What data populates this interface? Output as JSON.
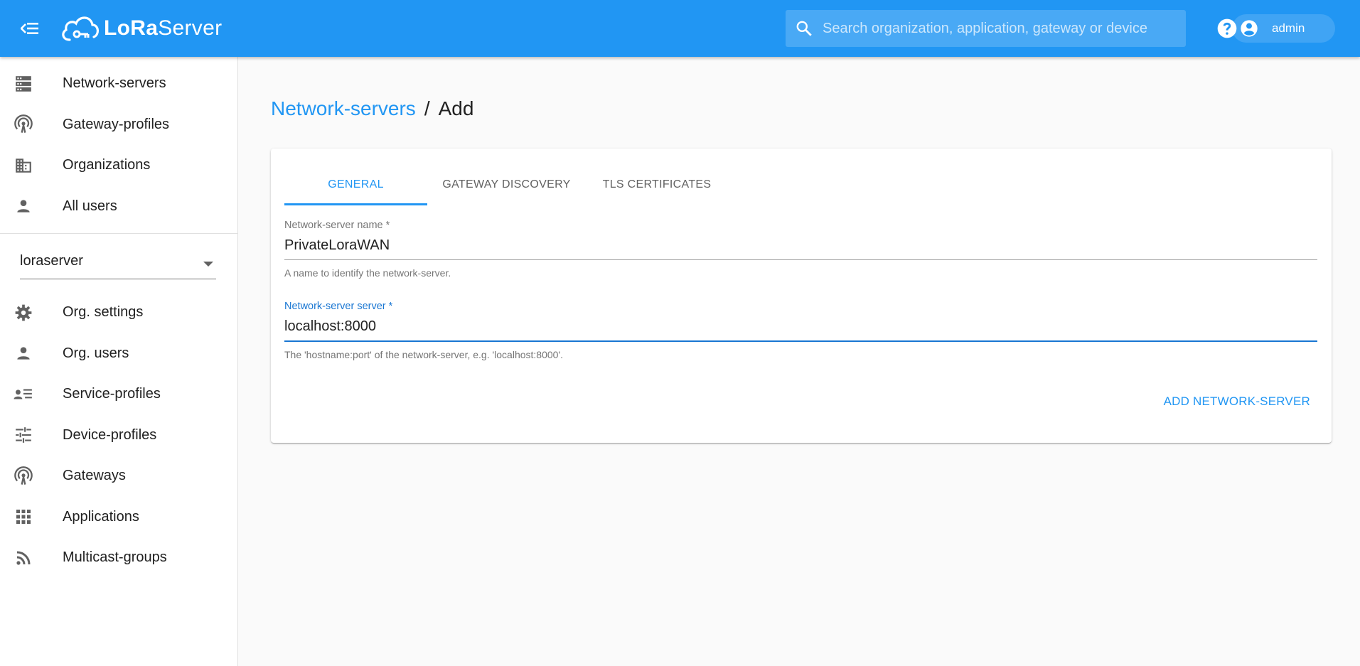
{
  "header": {
    "brand_name": "LoRaServer",
    "brand_bold": "LoRa",
    "brand_rest": "Server",
    "search_placeholder": "Search organization, application, gateway or device",
    "user_name": "admin",
    "color": "#2196f3"
  },
  "sidebar": {
    "admin_items": [
      {
        "label": "Network-servers",
        "icon": "server-icon"
      },
      {
        "label": "Gateway-profiles",
        "icon": "antenna-icon"
      },
      {
        "label": "Organizations",
        "icon": "building-icon"
      },
      {
        "label": "All users",
        "icon": "person-icon"
      }
    ],
    "org_select_value": "loraserver",
    "org_items": [
      {
        "label": "Org. settings",
        "icon": "gear-icon"
      },
      {
        "label": "Org. users",
        "icon": "person-icon"
      },
      {
        "label": "Service-profiles",
        "icon": "account-details-icon"
      },
      {
        "label": "Device-profiles",
        "icon": "tune-icon"
      },
      {
        "label": "Gateways",
        "icon": "antenna-icon"
      },
      {
        "label": "Applications",
        "icon": "apps-grid-icon"
      },
      {
        "label": "Multicast-groups",
        "icon": "rss-icon"
      }
    ]
  },
  "breadcrumb": {
    "parent": "Network-servers",
    "separator": "/",
    "current": "Add"
  },
  "form": {
    "tabs": [
      "GENERAL",
      "GATEWAY DISCOVERY",
      "TLS CERTIFICATES"
    ],
    "active_tab": "GENERAL",
    "name_label": "Network-server name *",
    "name_value": "PrivateLoraWAN",
    "name_help": "A name to identify the network-server.",
    "server_label": "Network-server server *",
    "server_value": "localhost:8000",
    "server_help": "The 'hostname:port' of the network-server, e.g. 'localhost:8000'.",
    "submit_label": "ADD NETWORK-SERVER"
  }
}
